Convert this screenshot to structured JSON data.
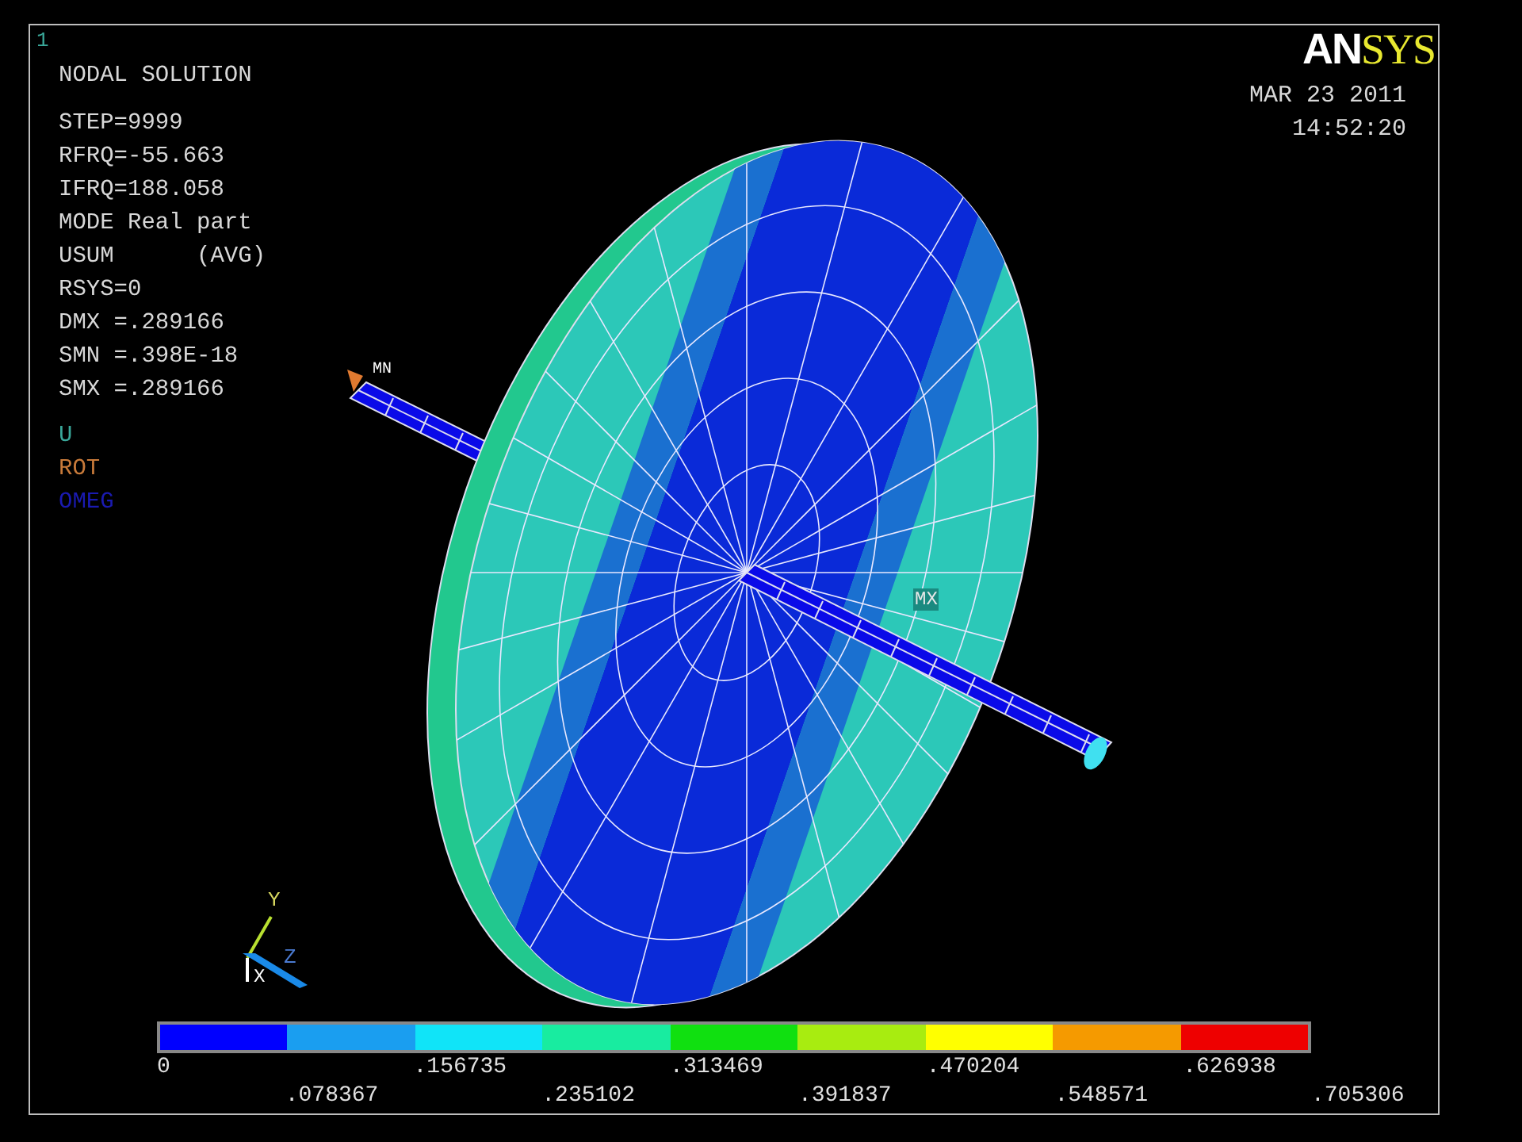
{
  "window_number": "1",
  "title": "NODAL SOLUTION",
  "info_lines": [
    "STEP=9999",
    "RFRQ=-55.663",
    "IFRQ=188.058",
    "MODE Real part",
    "USUM      (AVG)",
    "RSYS=0",
    "DMX =.289166",
    "SMN =.398E-18",
    "SMX =.289166"
  ],
  "symbol_legend": [
    {
      "label": "U",
      "color": "#3aa89a"
    },
    {
      "label": "ROT",
      "color": "#c87a3a"
    },
    {
      "label": "OMEG",
      "color": "#1a1ab0"
    }
  ],
  "logo": {
    "part_1": "AN",
    "part_2": "SYS"
  },
  "date": "MAR 23 2011",
  "time": "14:52:20",
  "min_label": "MN",
  "max_label": "MX",
  "triad": {
    "y_label": "Y",
    "z_label": "Z",
    "x_label": "X"
  },
  "contour_bands": [
    {
      "color": "#0000ff"
    },
    {
      "color": "#1a9ef0"
    },
    {
      "color": "#10e4f8"
    },
    {
      "color": "#18eca0"
    },
    {
      "color": "#10e010"
    },
    {
      "color": "#a8ec10"
    },
    {
      "color": "#ffff00"
    },
    {
      "color": "#f59a00"
    },
    {
      "color": "#ee0000"
    }
  ],
  "contour_ticks": [
    "0",
    ".078367",
    ".156735",
    ".235102",
    ".313469",
    ".391837",
    ".470204",
    ".548571",
    ".626938",
    ".705306"
  ]
}
